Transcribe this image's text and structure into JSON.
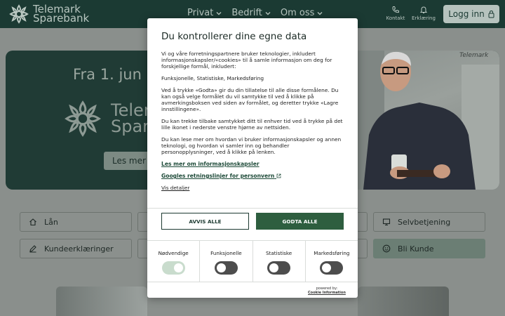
{
  "header": {
    "brand_line1": "Telemark",
    "brand_line2": "Sparebank",
    "nav": [
      "Privat",
      "Bedrift",
      "Om oss"
    ],
    "contact_label": "Kontakt",
    "declare_label": "Erklæring",
    "login_label": "Logg inn"
  },
  "hero": {
    "headline": "Fra 1. jun",
    "brand_line1": "Telem",
    "brand_line2": "Sparb",
    "button_label": "Les mer",
    "photo_sign": "Telemark"
  },
  "quick_links": {
    "loan": "Lån",
    "self_service": "Selvbetjening",
    "declarations": "Kundeerklæringer",
    "become_customer": "Bli Kunde"
  },
  "consent": {
    "title": "Du kontrollerer dine egne data",
    "paragraphs": [
      "Vi og våre forretningspartnere bruker teknologier, inkludert informasjonskapsler/«cookies» til å samle informasjon om deg for forskjellige formål, inkludert:",
      "Funksjonelle, Statistiske, Markedsføring",
      "Ved å trykke «Godta» gir du din tillatelse til alle disse formålene. Du kan også velge formålet du vil samtykke til ved å klikke på avmerkingsboksen ved siden av formålet, og deretter trykke «Lagre innstillingene».",
      "Du kan trekke tilbake samtykket ditt til enhver tid ved å trykke på det lille ikonet i nederste venstre hjørne av nettsiden.",
      "Du kan lese mer om hvordan vi bruker informasjonskapsler og annen teknologi, og hvordan vi samler inn og behandler personopplysninger, ved å klikke på lenken."
    ],
    "link_cookies": "Les mer om informasjonskapsler",
    "link_google": "Googles retningslinjer for personvern",
    "details": "Vis detaljer",
    "reject_label": "AVVIS ALLE",
    "accept_label": "GODTA ALLE",
    "categories": [
      {
        "label": "Nødvendige",
        "enabled": true
      },
      {
        "label": "Funksjonelle",
        "enabled": false
      },
      {
        "label": "Statistiske",
        "enabled": false
      },
      {
        "label": "Markedsføring",
        "enabled": false
      }
    ],
    "powered_by": "powered by:",
    "powered_brand": "Cookie Information"
  },
  "colors": {
    "brand_dark": "#1b3a33",
    "accept_green": "#2e5e3f",
    "toggle_on": "#c9dccd",
    "toggle_off": "#4d4d4d"
  }
}
